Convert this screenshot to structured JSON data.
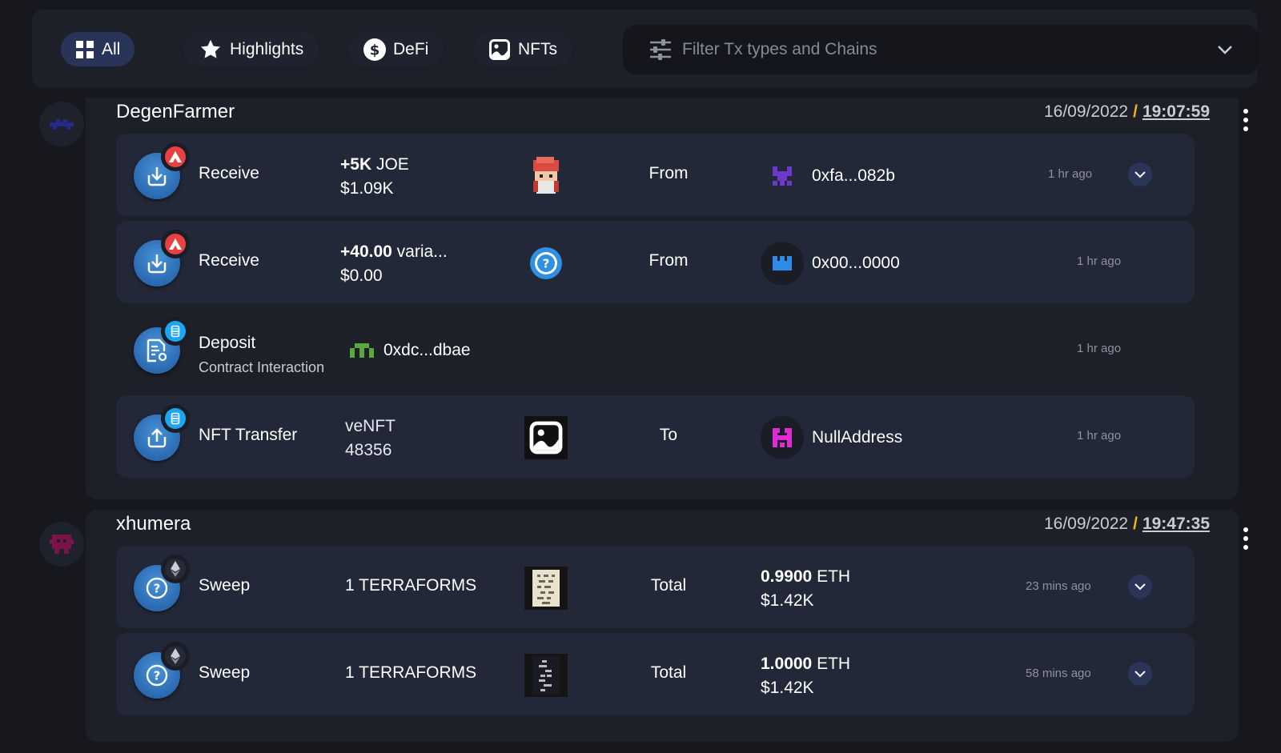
{
  "filters": {
    "tabs": [
      {
        "label": "All",
        "icon": "grid-icon",
        "active": true
      },
      {
        "label": "Highlights",
        "icon": "star-icon",
        "active": false
      },
      {
        "label": "DeFi",
        "icon": "dollar-icon",
        "active": false
      },
      {
        "label": "NFTs",
        "icon": "image-icon",
        "active": false
      }
    ],
    "select_placeholder": "Filter Tx types and Chains"
  },
  "groups": [
    {
      "name": "DegenFarmer",
      "date": "16/09/2022",
      "slash": "/",
      "time": "19:07:59",
      "rows": [
        {
          "type": "Receive",
          "amount_bold": "+5K",
          "amount_rest": " JOE",
          "usd": "$1.09K",
          "direction": "From",
          "party": "0xfa...082b",
          "ago": "1 hr ago",
          "chain_icon": "avalanche-icon"
        },
        {
          "type": "Receive",
          "amount_bold": "+40.00",
          "amount_rest": " varia...",
          "usd": "$0.00",
          "direction": "From",
          "party": "0x00...0000",
          "ago": "1 hr ago",
          "chain_icon": "avalanche-icon"
        },
        {
          "type": "Deposit",
          "subtitle": "Contract Interaction",
          "party": "0xdc...dbae",
          "ago": "1 hr ago",
          "chain_icon": "fantom-icon"
        },
        {
          "type": "NFT Transfer",
          "nft_name": "veNFT",
          "nft_id": "48356",
          "direction": "To",
          "party": "NullAddress",
          "ago": "1 hr ago",
          "chain_icon": "fantom-icon"
        }
      ]
    },
    {
      "name": "xhumera",
      "date": "16/09/2022",
      "slash": "/",
      "time": "19:47:35",
      "rows": [
        {
          "type": "Sweep",
          "item": "1 TERRAFORMS",
          "direction": "Total",
          "total_bold": "0.9900",
          "total_unit": " ETH",
          "usd": "$1.42K",
          "ago": "23 mins ago",
          "chain_icon": "ethereum-icon"
        },
        {
          "type": "Sweep",
          "item": "1 TERRAFORMS",
          "direction": "Total",
          "total_bold": "1.0000",
          "total_unit": " ETH",
          "usd": "$1.42K",
          "ago": "58 mins ago",
          "chain_icon": "ethereum-icon"
        }
      ]
    }
  ],
  "colors": {
    "background": "#16181e",
    "panel": "#1d2029",
    "row": "#232838",
    "active_tab": "#283558",
    "accent_yellow": "#f3b41b",
    "icon_blue": "#2e6fb8"
  }
}
